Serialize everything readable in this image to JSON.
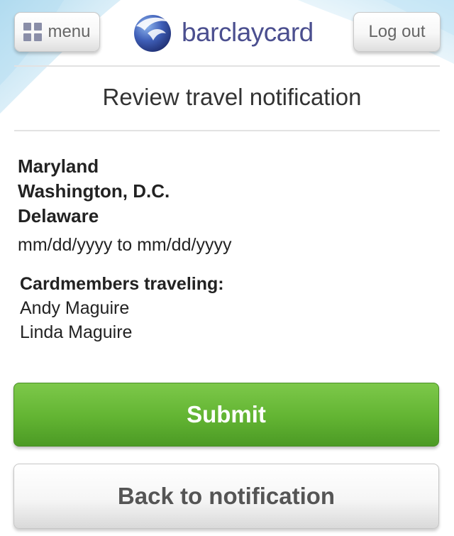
{
  "header": {
    "menu_label": "menu",
    "brand": "barclaycard",
    "logout_label": "Log out"
  },
  "page": {
    "title": "Review travel notification"
  },
  "trip": {
    "locations": [
      "Maryland",
      "Washington, D.C.",
      "Delaware"
    ],
    "date_range": "mm/dd/yyyy to mm/dd/yyyy"
  },
  "cardmembers": {
    "label": "Cardmembers traveling:",
    "names": [
      "Andy Maguire",
      "Linda Maguire"
    ]
  },
  "actions": {
    "submit_label": "Submit",
    "back_label": "Back to notification"
  },
  "colors": {
    "brand_blue": "#4b4f8f",
    "submit_green": "#62b432",
    "swoosh_blue": "#8fcbe8"
  }
}
